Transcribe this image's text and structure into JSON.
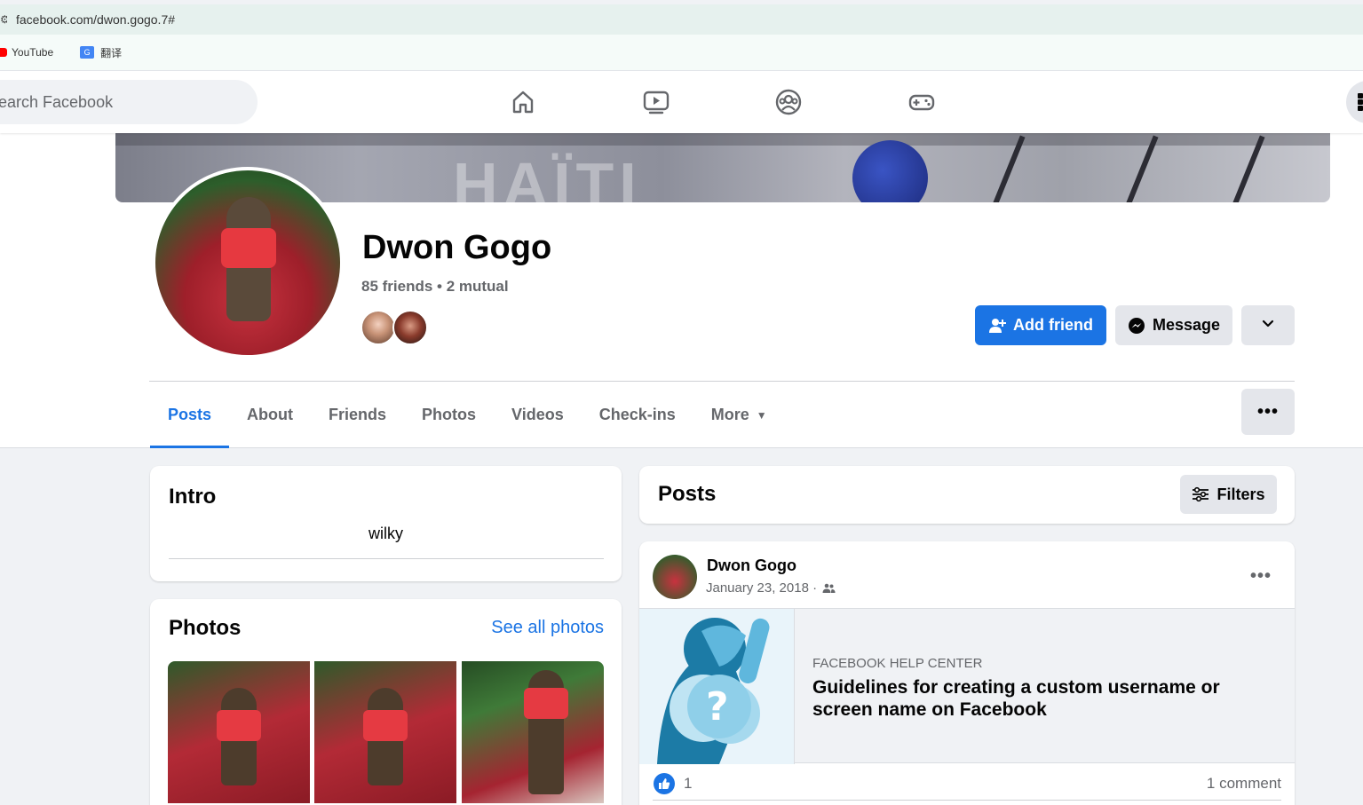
{
  "browser": {
    "url": "facebook.com/dwon.gogo.7#",
    "bookmarks": [
      {
        "label": "YouTube",
        "icon": "youtube-icon"
      },
      {
        "label": "翻译",
        "icon": "google-translate-icon"
      }
    ]
  },
  "nav": {
    "search_placeholder": "earch Facebook",
    "icons": [
      "home-icon",
      "watch-icon",
      "groups-icon",
      "gaming-icon"
    ]
  },
  "profile": {
    "name": "Dwon Gogo",
    "friends_line": "85 friends • 2 mutual",
    "add_friend_label": "Add friend",
    "message_label": "Message",
    "tabs": [
      "Posts",
      "About",
      "Friends",
      "Photos",
      "Videos",
      "Check-ins",
      "More"
    ],
    "active_tab": "Posts"
  },
  "intro": {
    "title": "Intro",
    "bio": "wilky"
  },
  "photos": {
    "title": "Photos",
    "see_all": "See all photos"
  },
  "posts": {
    "title": "Posts",
    "filters_label": "Filters",
    "post": {
      "author": "Dwon Gogo",
      "date": "January 23, 2018 ·",
      "link_domain": "FACEBOOK HELP CENTER",
      "link_title": "Guidelines for creating a custom username or screen name on Facebook",
      "reaction_count": "1",
      "comments": "1 comment"
    }
  },
  "colors": {
    "accent": "#1b74e4",
    "background": "#f0f2f5"
  }
}
